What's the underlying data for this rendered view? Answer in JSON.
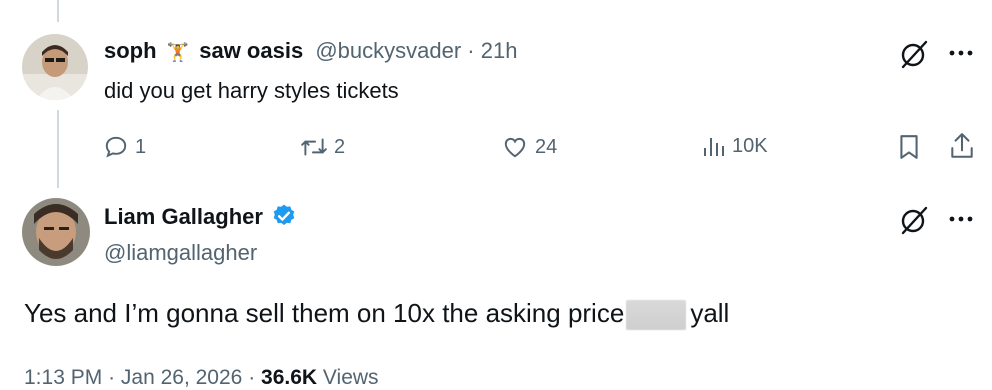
{
  "reply_tweet": {
    "display_name": "soph",
    "name_emoji": "🏋",
    "name_suffix": "saw oasis",
    "handle": "@buckysvader",
    "separator": "·",
    "time": "21h",
    "text": "did you get harry styles tickets",
    "actions": {
      "replies": "1",
      "retweets": "2",
      "likes": "24",
      "views": "10K"
    }
  },
  "main_tweet": {
    "display_name": "Liam Gallagher",
    "verified": true,
    "handle": "@liamgallagher",
    "text_before": "Yes and I’m gonna sell them on 10x the asking price",
    "text_after": "yall",
    "time": "1:13 PM",
    "separator": "·",
    "date": "Jan 26, 2026",
    "separator2": "·",
    "views_count": "36.6K",
    "views_label": "Views"
  },
  "colors": {
    "text": "#0f1419",
    "muted": "#536471",
    "verified": "#1d9bf0",
    "divider": "#cfd9de"
  },
  "icons": [
    "grok-icon",
    "more-icon",
    "reply-icon",
    "retweet-icon",
    "like-icon",
    "views-icon",
    "bookmark-icon",
    "share-icon",
    "verified-badge-icon"
  ]
}
